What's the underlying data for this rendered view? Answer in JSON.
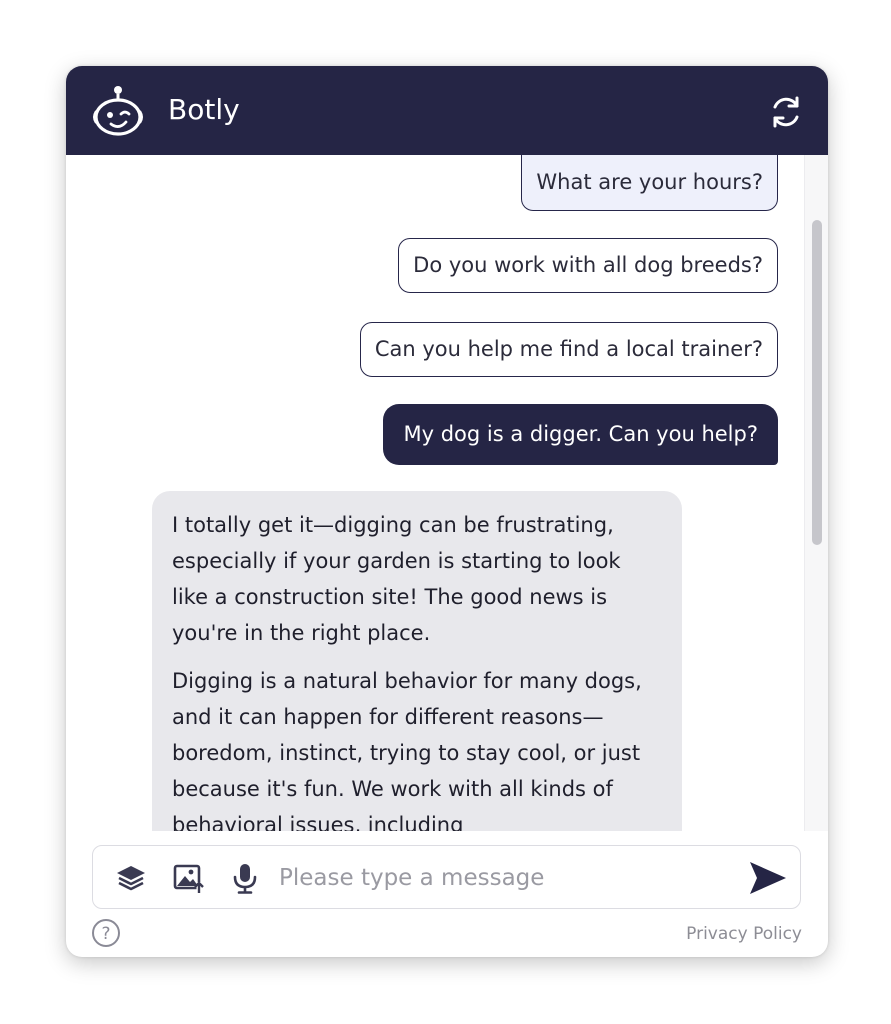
{
  "header": {
    "title": "Botly",
    "logo_icon": "robot-winking-icon",
    "refresh_icon": "refresh-icon"
  },
  "colors": {
    "brand": "#252545",
    "bot_bubble": "#e8e8ec",
    "chip_selected": "#eef0fb"
  },
  "suggestions": [
    {
      "label": "What are your hours?",
      "selected": true
    },
    {
      "label": "Do you work with all dog breeds?",
      "selected": false
    },
    {
      "label": "Can you help me find a local trainer?",
      "selected": false
    }
  ],
  "messages": {
    "user": "My dog is a digger. Can you help?",
    "bot_paragraphs": [
      "I totally get it—digging can be frustrating, especially if your garden is starting to look like a construction site! The good news is you're in the right place.",
      "Digging is a natural behavior for many dogs, and it can happen for different reasons—boredom, instinct, trying to stay cool, or just because it's fun. We work with all kinds of behavioral issues, including"
    ]
  },
  "composer": {
    "placeholder": "Please type a message",
    "tools": [
      "layers-icon",
      "image-upload-icon",
      "microphone-icon"
    ],
    "send_icon": "send-icon"
  },
  "footer": {
    "help_icon": "help-circle-icon",
    "privacy_label": "Privacy Policy"
  }
}
